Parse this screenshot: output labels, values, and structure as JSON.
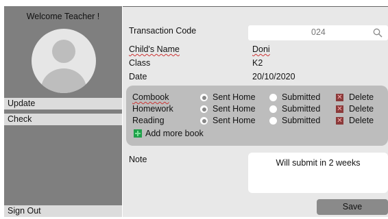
{
  "sidebar": {
    "welcome": "Welcome Teacher !",
    "items": [
      {
        "label": "Update"
      },
      {
        "label": "Check"
      },
      {
        "label": "Sign Out"
      }
    ]
  },
  "form": {
    "transaction_code_label": "Transaction Code",
    "transaction_code_value": "024",
    "child_name_label": "Child's Name",
    "child_name_value": "Doni",
    "class_label": "Class",
    "class_value": "K2",
    "date_label": "Date",
    "date_value": "20/10/2020",
    "note_label": "Note",
    "note_value": "Will submit in 2 weeks"
  },
  "books": {
    "option_sent": "Sent Home",
    "option_submitted": "Submitted",
    "delete_label": "Delete",
    "add_label": "Add more book",
    "rows": [
      {
        "name": "Combook",
        "selected": "Sent Home"
      },
      {
        "name": "Homework",
        "selected": "Sent Home"
      },
      {
        "name": "Reading",
        "selected": "Sent Home"
      }
    ]
  },
  "actions": {
    "save_label": "Save"
  },
  "colors": {
    "sidebar_bg": "#7f7f7f",
    "main_bg": "#e8e8e8",
    "books_panel": "#bdbdbd",
    "add_icon": "#1fa04a",
    "delete_icon": "#8b3a3a"
  }
}
